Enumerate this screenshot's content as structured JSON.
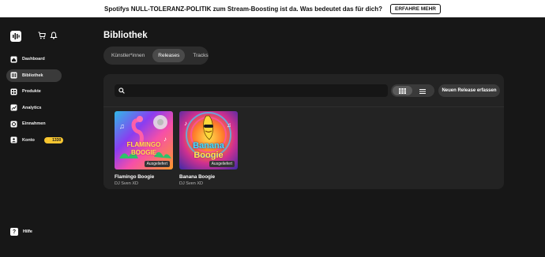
{
  "banner": {
    "text": "Spotifys NULL-TOLERANZ-POLITIK zum Stream-Boosting ist da. Was bedeutet das für dich?",
    "button": "ERFAHRE MEHR"
  },
  "sidebar": {
    "items": [
      {
        "label": "Dashboard",
        "icon": "home-icon"
      },
      {
        "label": "Bibliothek",
        "icon": "library-icon",
        "active": true
      },
      {
        "label": "Produkte",
        "icon": "grid-icon"
      },
      {
        "label": "Analytics",
        "icon": "chart-icon"
      },
      {
        "label": "Einnahmen",
        "icon": "money-icon"
      },
      {
        "label": "Konto",
        "icon": "user-icon"
      }
    ],
    "konto_badge": "1330",
    "help_label": "Hilfe"
  },
  "main": {
    "title": "Bibliothek",
    "tabs": [
      {
        "label": "Künstler*innen"
      },
      {
        "label": "Releases",
        "active": true
      },
      {
        "label": "Tracks"
      }
    ],
    "search_placeholder": "",
    "new_release_label": "Neuen Release erfassen",
    "view_mode": "grid"
  },
  "releases": [
    {
      "title": "Flamingo Boogie",
      "artist": "DJ Sven XD",
      "status": "Ausgeliefert",
      "cover_text_1": "FLAMINGO",
      "cover_text_2": "BOOGIE"
    },
    {
      "title": "Banana Boogie",
      "artist": "DJ Sven XD",
      "status": "Ausgeliefert",
      "cover_text_1": "Banana",
      "cover_text_2": "Boogie"
    }
  ],
  "colors": {
    "background": "#171717",
    "panel": "#232323",
    "badge": "#f6c531"
  }
}
